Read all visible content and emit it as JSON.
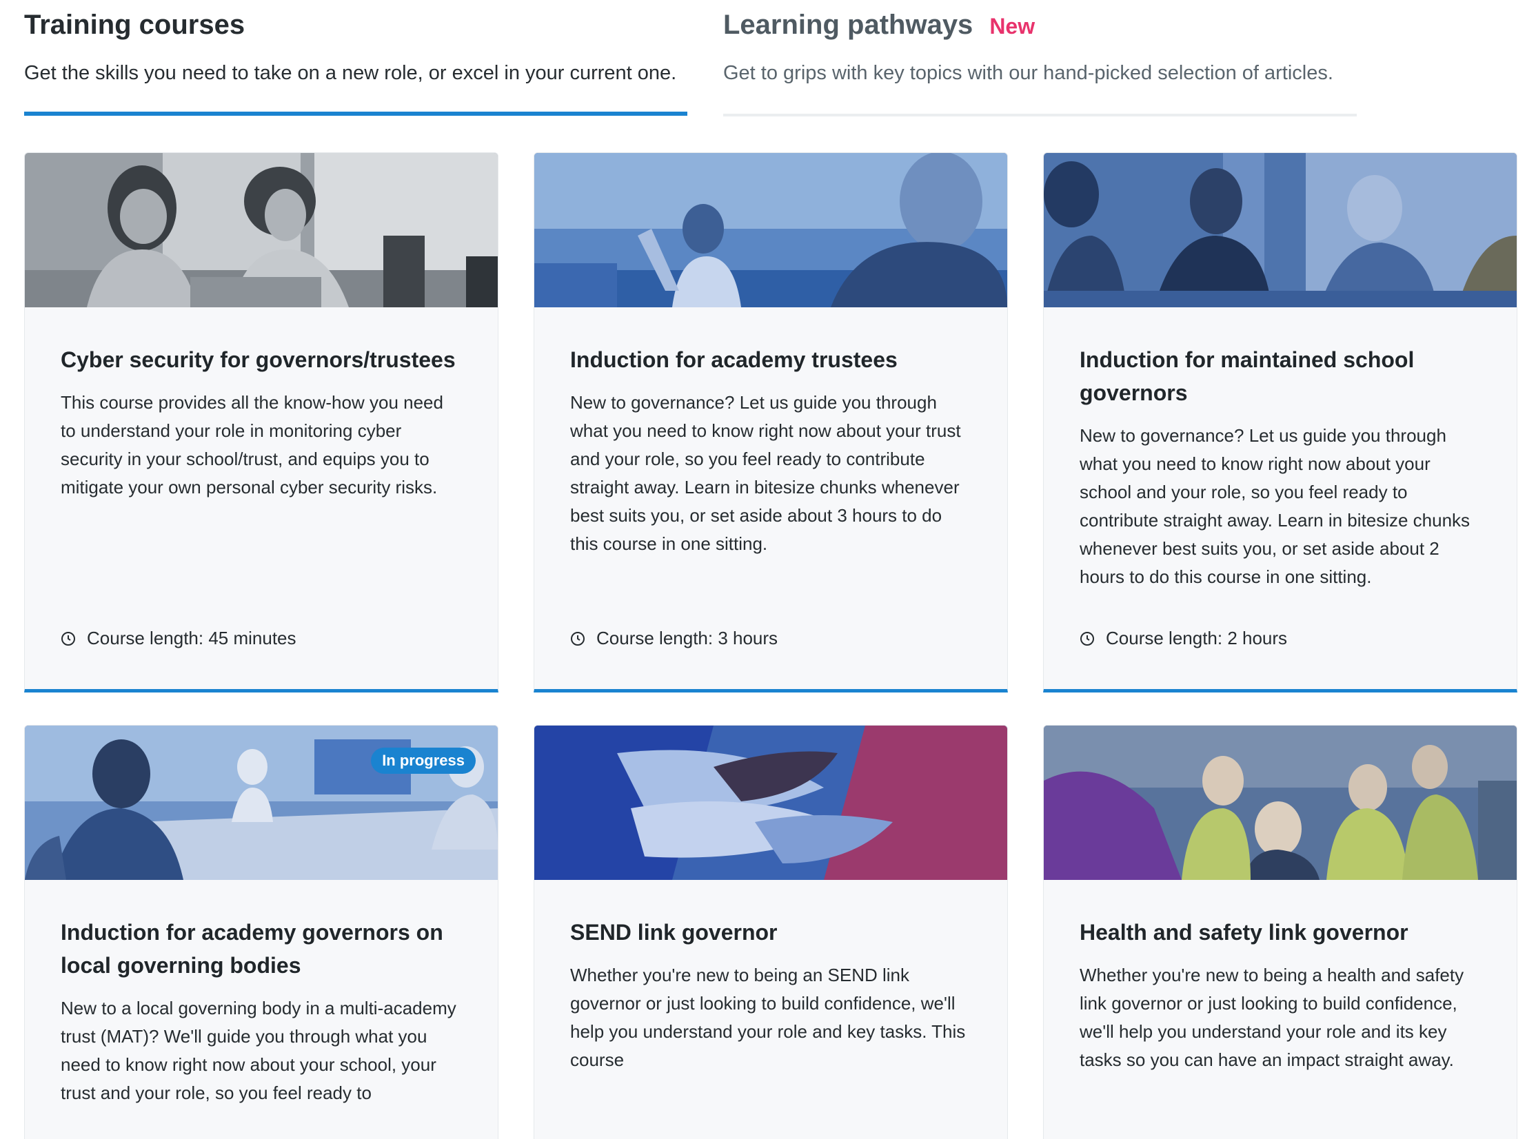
{
  "tabs": [
    {
      "title": "Training courses",
      "description": "Get the skills you need to take on a new role, or excel in your current one.",
      "badge": ""
    },
    {
      "title": "Learning pathways",
      "description": "Get to grips with key topics with our hand-picked selection of articles.",
      "badge": "New"
    }
  ],
  "courses": [
    {
      "title": "Cyber security for governors/trustees",
      "description": "This course provides all the know-how you need to understand your role in monitoring cyber security in your school/trust, and equips you to mitigate your own personal cyber security risks.",
      "length": "Course length: 45 minutes",
      "image": "two-women-laptop-photo"
    },
    {
      "title": "Induction for academy trustees",
      "description": "New to governance? Let us guide you through what you need to know right now about your trust and your role, so you feel ready to contribute straight away. Learn in bitesize chunks whenever best suits you, or set aside about 3 hours to do this course in one sitting.",
      "length": "Course length: 3 hours",
      "image": "man-gesturing-meeting-photo"
    },
    {
      "title": "Induction for maintained school governors",
      "description": "New to governance? Let us guide you through what you need to know right now about your school and your role, so you feel ready to contribute straight away. Learn in bitesize chunks whenever best suits you, or set aside about 2 hours to do this course in one sitting.",
      "length": "Course length: 2 hours",
      "image": "group-discussion-photo"
    },
    {
      "title": "Induction for academy governors on local governing bodies",
      "description": "New to a local governing body in a multi-academy trust (MAT)? We'll guide you through what you need to know right now about your school, your trust and your role, so you feel ready to",
      "length": "",
      "badge": "In progress",
      "image": "meeting-table-photo"
    },
    {
      "title": "SEND link governor",
      "description": "Whether you're new to being an SEND link governor or just looking to build confidence, we'll help you understand your role and key tasks. This course",
      "length": "",
      "image": "stacked-hands-photo"
    },
    {
      "title": "Health and safety link governor",
      "description": "Whether you're new to being a health and safety link governor or just looking to build confidence, we'll help you understand your role and its key tasks so you can have an impact straight away.",
      "length": "",
      "image": "children-hi-vis-photo"
    }
  ],
  "colors": {
    "accent": "#1a83d0",
    "badge_new": "#e8336c",
    "card_bg": "#f7f8fa"
  }
}
